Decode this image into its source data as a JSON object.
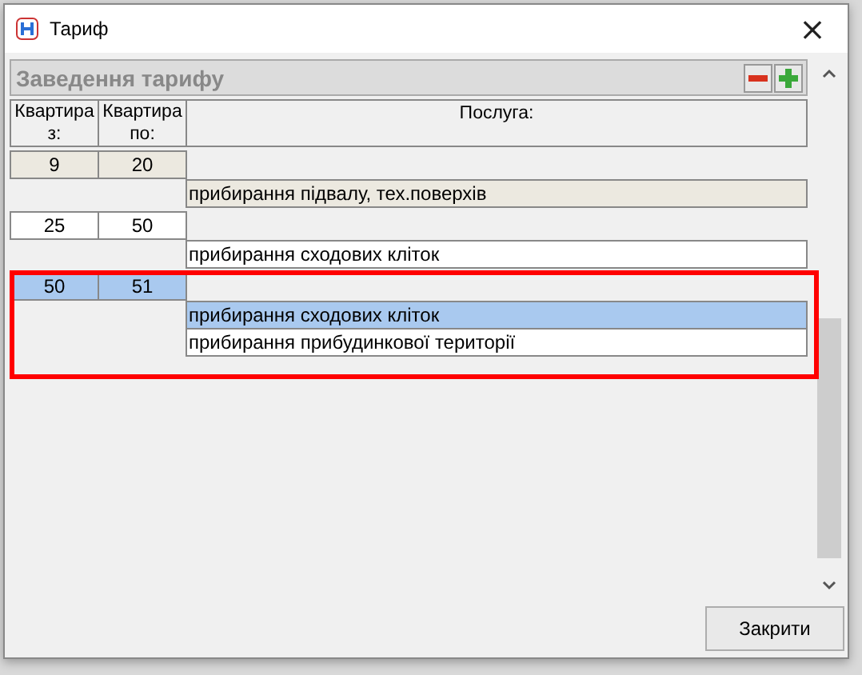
{
  "window": {
    "title": "Тариф",
    "close": "×"
  },
  "section": {
    "title": "Заведення тарифу"
  },
  "columns": [
    "Квартира з:",
    "Квартира по:",
    "Послуга:"
  ],
  "groups": [
    {
      "from": "9",
      "to": "20",
      "selected": false,
      "shaded": true,
      "services": [
        {
          "name": "прибирання підвалу, тех.поверхів",
          "selected": false,
          "shaded": true
        }
      ]
    },
    {
      "from": "25",
      "to": "50",
      "selected": false,
      "shaded": false,
      "services": [
        {
          "name": "прибирання сходових кліток",
          "selected": false,
          "shaded": false
        }
      ]
    },
    {
      "from": "50",
      "to": "51",
      "selected": true,
      "services": [
        {
          "name": "прибирання сходових кліток",
          "selected": true
        },
        {
          "name": "прибирання прибудинкової території",
          "selected": false,
          "shaded": false
        }
      ]
    }
  ],
  "buttons": [
    {
      "label": "Закрити"
    }
  ]
}
